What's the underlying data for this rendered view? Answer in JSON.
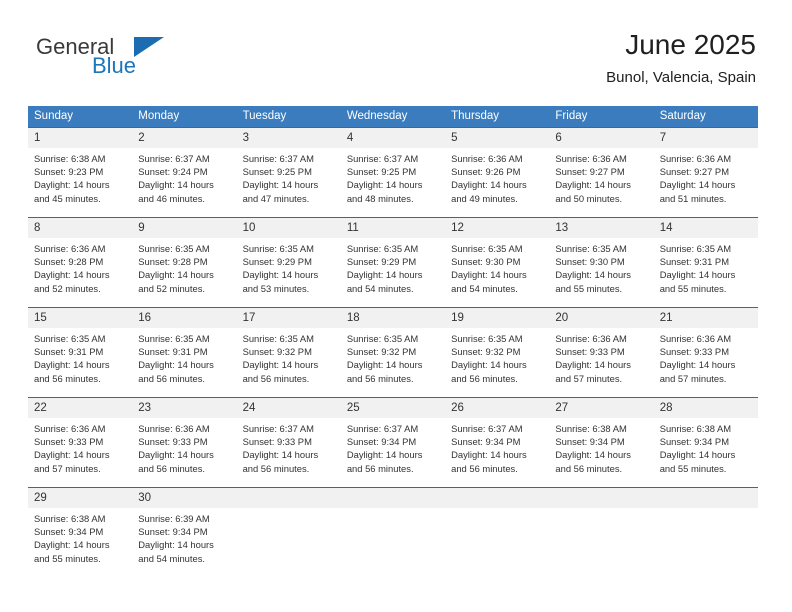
{
  "brand": {
    "name_part1": "General",
    "name_part2": "Blue",
    "accent_color": "#1b6cb0"
  },
  "header": {
    "title": "June 2025",
    "location": "Bunol, Valencia, Spain"
  },
  "theme": {
    "header_bg": "#3a7cbe",
    "row_divider": "#2e6da4",
    "daynum_bg": "#f1f1f1",
    "text": "#333333"
  },
  "weekdays": [
    "Sunday",
    "Monday",
    "Tuesday",
    "Wednesday",
    "Thursday",
    "Friday",
    "Saturday"
  ],
  "weeks": [
    [
      {
        "day": "1",
        "sunrise": "Sunrise: 6:38 AM",
        "sunset": "Sunset: 9:23 PM",
        "daylight1": "Daylight: 14 hours",
        "daylight2": "and 45 minutes."
      },
      {
        "day": "2",
        "sunrise": "Sunrise: 6:37 AM",
        "sunset": "Sunset: 9:24 PM",
        "daylight1": "Daylight: 14 hours",
        "daylight2": "and 46 minutes."
      },
      {
        "day": "3",
        "sunrise": "Sunrise: 6:37 AM",
        "sunset": "Sunset: 9:25 PM",
        "daylight1": "Daylight: 14 hours",
        "daylight2": "and 47 minutes."
      },
      {
        "day": "4",
        "sunrise": "Sunrise: 6:37 AM",
        "sunset": "Sunset: 9:25 PM",
        "daylight1": "Daylight: 14 hours",
        "daylight2": "and 48 minutes."
      },
      {
        "day": "5",
        "sunrise": "Sunrise: 6:36 AM",
        "sunset": "Sunset: 9:26 PM",
        "daylight1": "Daylight: 14 hours",
        "daylight2": "and 49 minutes."
      },
      {
        "day": "6",
        "sunrise": "Sunrise: 6:36 AM",
        "sunset": "Sunset: 9:27 PM",
        "daylight1": "Daylight: 14 hours",
        "daylight2": "and 50 minutes."
      },
      {
        "day": "7",
        "sunrise": "Sunrise: 6:36 AM",
        "sunset": "Sunset: 9:27 PM",
        "daylight1": "Daylight: 14 hours",
        "daylight2": "and 51 minutes."
      }
    ],
    [
      {
        "day": "8",
        "sunrise": "Sunrise: 6:36 AM",
        "sunset": "Sunset: 9:28 PM",
        "daylight1": "Daylight: 14 hours",
        "daylight2": "and 52 minutes."
      },
      {
        "day": "9",
        "sunrise": "Sunrise: 6:35 AM",
        "sunset": "Sunset: 9:28 PM",
        "daylight1": "Daylight: 14 hours",
        "daylight2": "and 52 minutes."
      },
      {
        "day": "10",
        "sunrise": "Sunrise: 6:35 AM",
        "sunset": "Sunset: 9:29 PM",
        "daylight1": "Daylight: 14 hours",
        "daylight2": "and 53 minutes."
      },
      {
        "day": "11",
        "sunrise": "Sunrise: 6:35 AM",
        "sunset": "Sunset: 9:29 PM",
        "daylight1": "Daylight: 14 hours",
        "daylight2": "and 54 minutes."
      },
      {
        "day": "12",
        "sunrise": "Sunrise: 6:35 AM",
        "sunset": "Sunset: 9:30 PM",
        "daylight1": "Daylight: 14 hours",
        "daylight2": "and 54 minutes."
      },
      {
        "day": "13",
        "sunrise": "Sunrise: 6:35 AM",
        "sunset": "Sunset: 9:30 PM",
        "daylight1": "Daylight: 14 hours",
        "daylight2": "and 55 minutes."
      },
      {
        "day": "14",
        "sunrise": "Sunrise: 6:35 AM",
        "sunset": "Sunset: 9:31 PM",
        "daylight1": "Daylight: 14 hours",
        "daylight2": "and 55 minutes."
      }
    ],
    [
      {
        "day": "15",
        "sunrise": "Sunrise: 6:35 AM",
        "sunset": "Sunset: 9:31 PM",
        "daylight1": "Daylight: 14 hours",
        "daylight2": "and 56 minutes."
      },
      {
        "day": "16",
        "sunrise": "Sunrise: 6:35 AM",
        "sunset": "Sunset: 9:31 PM",
        "daylight1": "Daylight: 14 hours",
        "daylight2": "and 56 minutes."
      },
      {
        "day": "17",
        "sunrise": "Sunrise: 6:35 AM",
        "sunset": "Sunset: 9:32 PM",
        "daylight1": "Daylight: 14 hours",
        "daylight2": "and 56 minutes."
      },
      {
        "day": "18",
        "sunrise": "Sunrise: 6:35 AM",
        "sunset": "Sunset: 9:32 PM",
        "daylight1": "Daylight: 14 hours",
        "daylight2": "and 56 minutes."
      },
      {
        "day": "19",
        "sunrise": "Sunrise: 6:35 AM",
        "sunset": "Sunset: 9:32 PM",
        "daylight1": "Daylight: 14 hours",
        "daylight2": "and 56 minutes."
      },
      {
        "day": "20",
        "sunrise": "Sunrise: 6:36 AM",
        "sunset": "Sunset: 9:33 PM",
        "daylight1": "Daylight: 14 hours",
        "daylight2": "and 57 minutes."
      },
      {
        "day": "21",
        "sunrise": "Sunrise: 6:36 AM",
        "sunset": "Sunset: 9:33 PM",
        "daylight1": "Daylight: 14 hours",
        "daylight2": "and 57 minutes."
      }
    ],
    [
      {
        "day": "22",
        "sunrise": "Sunrise: 6:36 AM",
        "sunset": "Sunset: 9:33 PM",
        "daylight1": "Daylight: 14 hours",
        "daylight2": "and 57 minutes."
      },
      {
        "day": "23",
        "sunrise": "Sunrise: 6:36 AM",
        "sunset": "Sunset: 9:33 PM",
        "daylight1": "Daylight: 14 hours",
        "daylight2": "and 56 minutes."
      },
      {
        "day": "24",
        "sunrise": "Sunrise: 6:37 AM",
        "sunset": "Sunset: 9:33 PM",
        "daylight1": "Daylight: 14 hours",
        "daylight2": "and 56 minutes."
      },
      {
        "day": "25",
        "sunrise": "Sunrise: 6:37 AM",
        "sunset": "Sunset: 9:34 PM",
        "daylight1": "Daylight: 14 hours",
        "daylight2": "and 56 minutes."
      },
      {
        "day": "26",
        "sunrise": "Sunrise: 6:37 AM",
        "sunset": "Sunset: 9:34 PM",
        "daylight1": "Daylight: 14 hours",
        "daylight2": "and 56 minutes."
      },
      {
        "day": "27",
        "sunrise": "Sunrise: 6:38 AM",
        "sunset": "Sunset: 9:34 PM",
        "daylight1": "Daylight: 14 hours",
        "daylight2": "and 56 minutes."
      },
      {
        "day": "28",
        "sunrise": "Sunrise: 6:38 AM",
        "sunset": "Sunset: 9:34 PM",
        "daylight1": "Daylight: 14 hours",
        "daylight2": "and 55 minutes."
      }
    ],
    [
      {
        "day": "29",
        "sunrise": "Sunrise: 6:38 AM",
        "sunset": "Sunset: 9:34 PM",
        "daylight1": "Daylight: 14 hours",
        "daylight2": "and 55 minutes."
      },
      {
        "day": "30",
        "sunrise": "Sunrise: 6:39 AM",
        "sunset": "Sunset: 9:34 PM",
        "daylight1": "Daylight: 14 hours",
        "daylight2": "and 54 minutes."
      },
      {
        "day": "",
        "sunrise": "",
        "sunset": "",
        "daylight1": "",
        "daylight2": "",
        "blank": true
      },
      {
        "day": "",
        "sunrise": "",
        "sunset": "",
        "daylight1": "",
        "daylight2": "",
        "blank": true
      },
      {
        "day": "",
        "sunrise": "",
        "sunset": "",
        "daylight1": "",
        "daylight2": "",
        "blank": true
      },
      {
        "day": "",
        "sunrise": "",
        "sunset": "",
        "daylight1": "",
        "daylight2": "",
        "blank": true
      },
      {
        "day": "",
        "sunrise": "",
        "sunset": "",
        "daylight1": "",
        "daylight2": "",
        "blank": true
      }
    ]
  ]
}
